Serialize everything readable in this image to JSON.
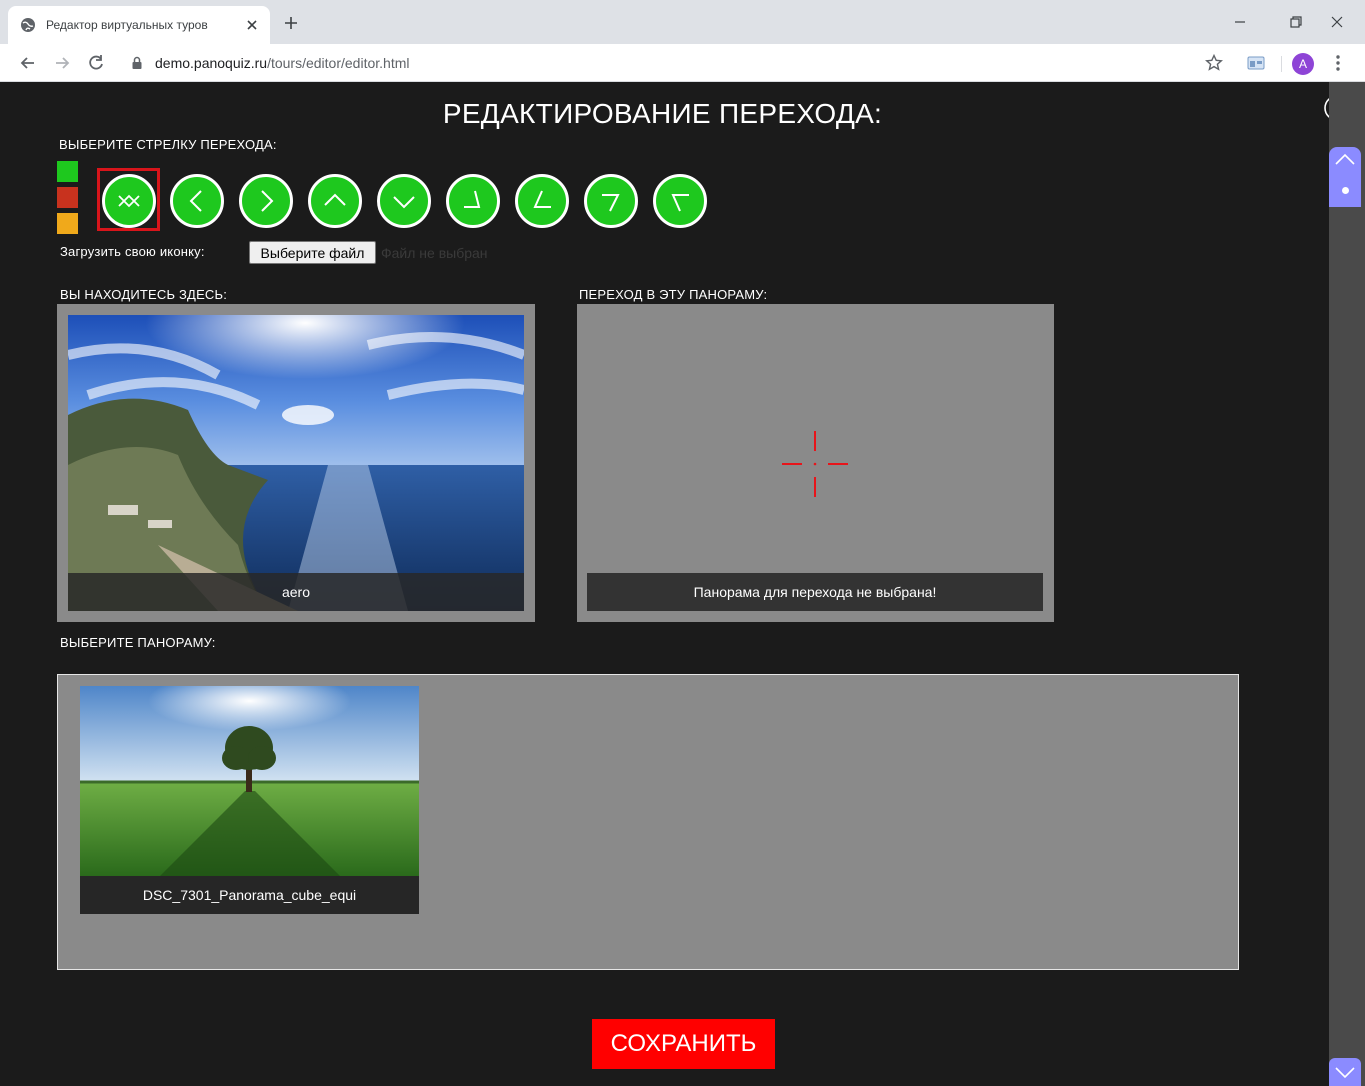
{
  "browser": {
    "tab_title": "Редактор виртуальных туров",
    "url_host": "demo.panoquiz.ru",
    "url_path": "/tours/editor/editor.html",
    "avatar_letter": "A"
  },
  "editor": {
    "title": "РЕДАКТИРОВАНИЕ ПЕРЕХОДА:",
    "choose_arrow_label": "ВЫБЕРИТЕ СТРЕЛКУ ПЕРЕХОДА:",
    "swatches": [
      "#1ec81e",
      "#c8321e",
      "#f0a91b"
    ],
    "arrows": [
      {
        "icon": "double-chevron-down-icon",
        "selected": true
      },
      {
        "icon": "chevron-left-icon",
        "selected": false
      },
      {
        "icon": "chevron-right-icon",
        "selected": false
      },
      {
        "icon": "chevron-up-icon",
        "selected": false
      },
      {
        "icon": "chevron-down-icon",
        "selected": false
      },
      {
        "icon": "corner-bottom-right-icon",
        "selected": false
      },
      {
        "icon": "corner-bottom-left-icon",
        "selected": false
      },
      {
        "icon": "corner-top-right-icon",
        "selected": false
      },
      {
        "icon": "corner-top-left-icon",
        "selected": false
      }
    ],
    "upload_label": "Загрузить свою иконку:",
    "file_button": "Выберите файл",
    "file_status": "Файл не выбран",
    "you_are_here_label": "ВЫ НАХОДИТЕСЬ ЗДЕСЬ:",
    "current_pano_name": "aero",
    "go_to_label": "ПЕРЕХОД В ЭТУ ПАНОРАМУ:",
    "target_pano_caption": "Панорама для перехода не выбрана!",
    "choose_pano_label": "ВЫБЕРИТЕ ПАНОРАМУ:",
    "panoramas": [
      {
        "name": "DSC_7301_Panorama_cube_equi"
      }
    ],
    "save_button": "СОХРАНИТЬ"
  },
  "colors": {
    "accent_green": "#1ec81e",
    "save_red": "#ff0000",
    "selected_frame": "#d8151b",
    "scroll_accent": "#8b8bff"
  }
}
